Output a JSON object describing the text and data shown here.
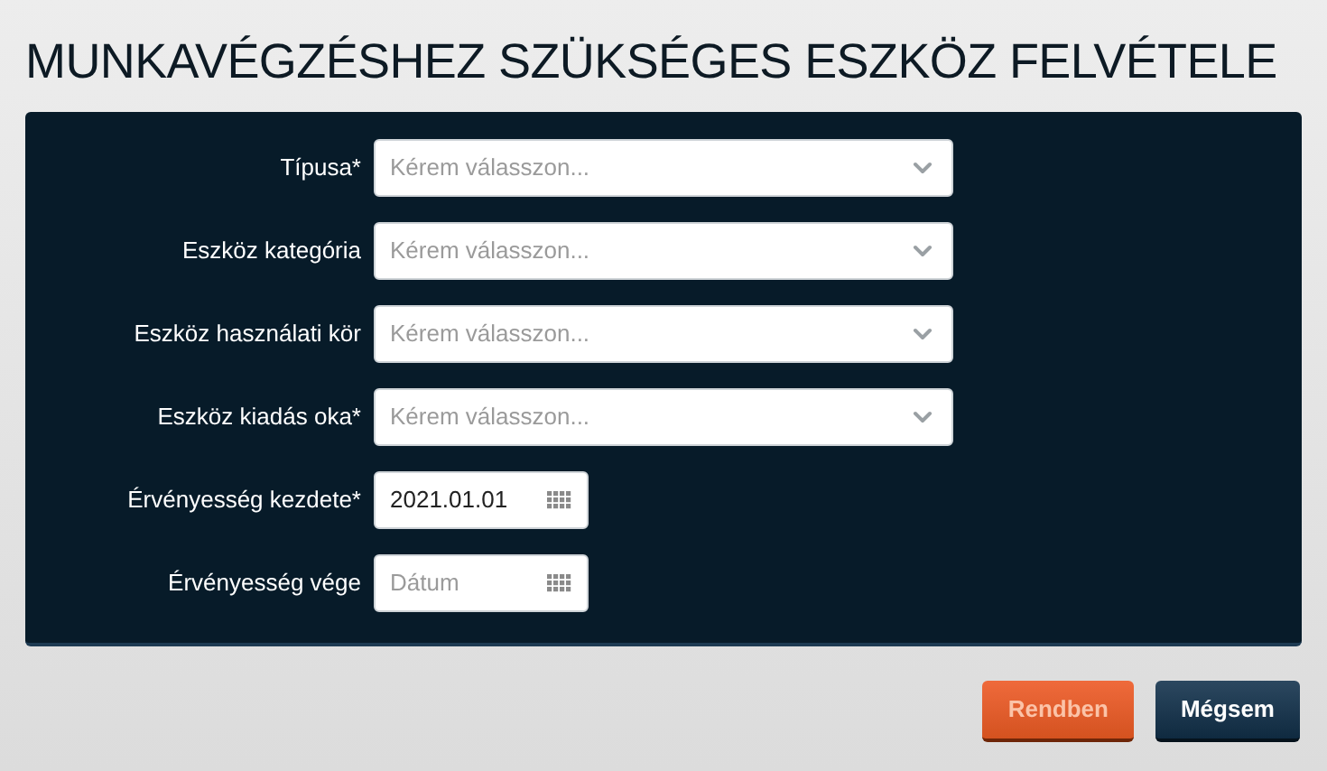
{
  "title": "MUNKAVÉGZÉSHEZ SZÜKSÉGES ESZKÖZ FELVÉTELE",
  "fields": [
    {
      "kind": "select",
      "label": "Típusa*",
      "placeholder": "Kérem válasszon..."
    },
    {
      "kind": "select",
      "label": "Eszköz kategória",
      "placeholder": "Kérem válasszon..."
    },
    {
      "kind": "select",
      "label": "Eszköz használati kör",
      "placeholder": "Kérem válasszon..."
    },
    {
      "kind": "select",
      "label": "Eszköz kiadás oka*",
      "placeholder": "Kérem válasszon..."
    },
    {
      "kind": "date",
      "label": "Érvényesség kezdete*",
      "value": "2021.01.01"
    },
    {
      "kind": "date",
      "label": "Érvényesség vége",
      "placeholder": "Dátum"
    }
  ],
  "buttons": [
    {
      "kind": "primary",
      "label": "Rendben",
      "disabled": true
    },
    {
      "kind": "secondary",
      "label": "Mégsem",
      "disabled": false
    }
  ]
}
